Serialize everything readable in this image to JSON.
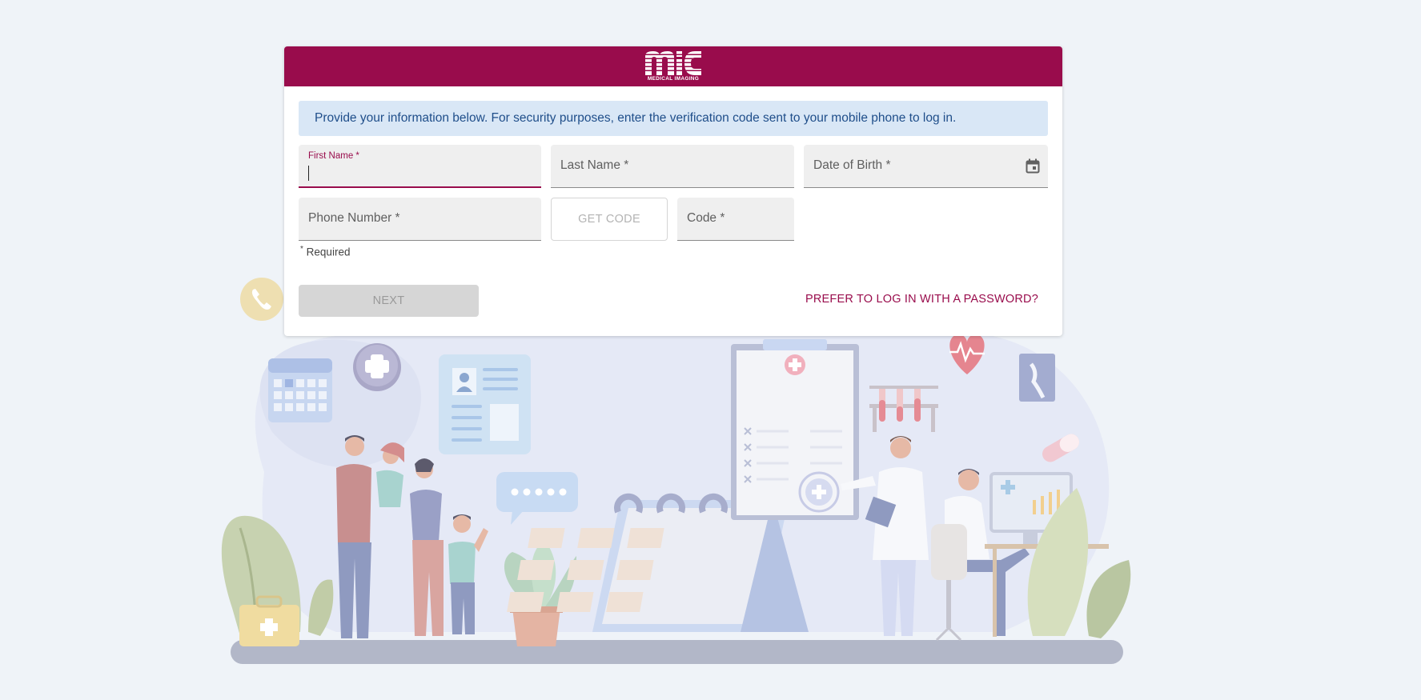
{
  "header": {
    "logo_text": "MEDICAL IMAGING",
    "brand_color": "#990c4c"
  },
  "banner": {
    "text": "Provide your information below. For security purposes, enter the verification code sent to your mobile phone to log in."
  },
  "form": {
    "first_name_label": "First Name *",
    "last_name_label": "Last Name *",
    "dob_label": "Date of Birth *",
    "phone_label": "Phone Number *",
    "get_code_label": "GET CODE",
    "code_label": "Code *",
    "required_label": "Required",
    "required_marker": "*"
  },
  "actions": {
    "next_label": "NEXT",
    "password_link": "PREFER TO LOG IN WITH A PASSWORD?"
  },
  "icons": {
    "calendar": "calendar-icon",
    "phone": "phone-icon"
  }
}
